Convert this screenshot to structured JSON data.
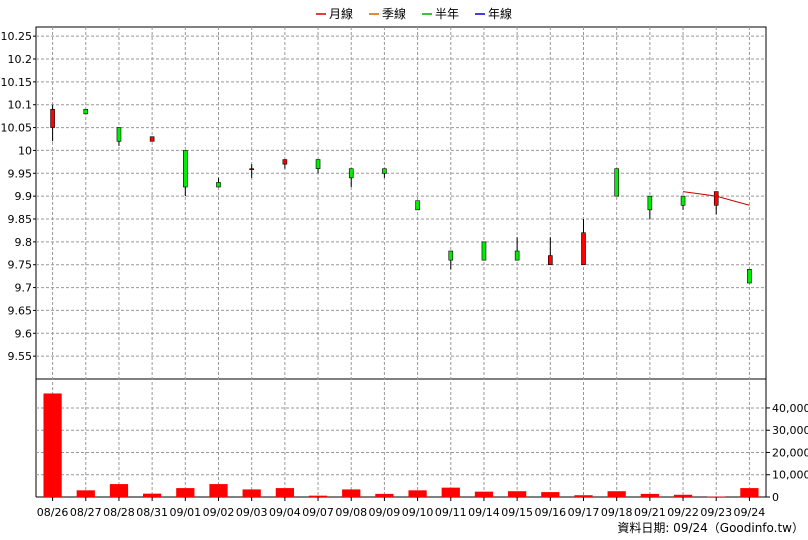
{
  "chart_data": {
    "type": "candlestick",
    "legend": [
      {
        "label": "月線",
        "color": "#cc0000"
      },
      {
        "label": "季線",
        "color": "#cc6600"
      },
      {
        "label": "半年",
        "color": "#00aa00"
      },
      {
        "label": "年線",
        "color": "#0000cc"
      }
    ],
    "categories": [
      "08/26",
      "08/27",
      "08/28",
      "08/31",
      "09/01",
      "09/02",
      "09/03",
      "09/04",
      "09/07",
      "09/08",
      "09/09",
      "09/10",
      "09/11",
      "09/14",
      "09/15",
      "09/16",
      "09/17",
      "09/18",
      "09/21",
      "09/22",
      "09/23",
      "09/24"
    ],
    "price_axis": {
      "ylim": [
        9.5,
        10.27
      ],
      "ticks": [
        "9.55",
        "9.6",
        "9.65",
        "9.7",
        "9.75",
        "9.8",
        "9.85",
        "9.9",
        "9.95",
        "10",
        "10.05",
        "10.1",
        "10.15",
        "10.2",
        "10.25"
      ]
    },
    "candles": [
      {
        "open": 10.05,
        "high": 10.1,
        "low": 10.02,
        "close": 10.09
      },
      {
        "open": 10.09,
        "high": 10.09,
        "low": 10.08,
        "close": 10.08
      },
      {
        "open": 10.05,
        "high": 10.05,
        "low": 10.01,
        "close": 10.02
      },
      {
        "open": 10.02,
        "high": 10.03,
        "low": 10.02,
        "close": 10.03
      },
      {
        "open": 10.0,
        "high": 10.0,
        "low": 9.9,
        "close": 9.92
      },
      {
        "open": 9.93,
        "high": 9.94,
        "low": 9.92,
        "close": 9.92
      },
      {
        "open": 9.96,
        "high": 9.97,
        "low": 9.94,
        "close": 9.96
      },
      {
        "open": 9.97,
        "high": 9.98,
        "low": 9.96,
        "close": 9.98
      },
      {
        "open": 9.98,
        "high": 9.98,
        "low": 9.95,
        "close": 9.96
      },
      {
        "open": 9.96,
        "high": 9.96,
        "low": 9.92,
        "close": 9.94
      },
      {
        "open": 9.96,
        "high": 9.96,
        "low": 9.94,
        "close": 9.95
      },
      {
        "open": 9.89,
        "high": 9.89,
        "low": 9.87,
        "close": 9.87
      },
      {
        "open": 9.78,
        "high": 9.78,
        "low": 9.74,
        "close": 9.76
      },
      {
        "open": 9.8,
        "high": 9.8,
        "low": 9.76,
        "close": 9.76
      },
      {
        "open": 9.78,
        "high": 9.81,
        "low": 9.76,
        "close": 9.76
      },
      {
        "open": 9.75,
        "high": 9.81,
        "low": 9.75,
        "close": 9.77
      },
      {
        "open": 9.75,
        "high": 9.85,
        "low": 9.75,
        "close": 9.82
      },
      {
        "open": 9.96,
        "high": 9.96,
        "low": 9.9,
        "close": 9.9
      },
      {
        "open": 9.9,
        "high": 9.9,
        "low": 9.85,
        "close": 9.87
      },
      {
        "open": 9.9,
        "high": 9.9,
        "low": 9.87,
        "close": 9.88
      },
      {
        "open": 9.88,
        "high": 9.91,
        "low": 9.86,
        "close": 9.91
      },
      {
        "open": 9.74,
        "high": 9.74,
        "low": 9.71,
        "close": 9.71
      }
    ],
    "monthly_ma": {
      "start_index": 19,
      "values": [
        9.91,
        9.9,
        9.88
      ]
    },
    "volume_axis": {
      "ylim": [
        0,
        53000
      ],
      "ticks": [
        {
          "value": 0,
          "label": "0"
        },
        {
          "value": 10000,
          "label": "10,000"
        },
        {
          "value": 20000,
          "label": "20,000"
        },
        {
          "value": 30000,
          "label": "30,000"
        },
        {
          "value": 40000,
          "label": "40,000"
        }
      ]
    },
    "volumes": [
      46500,
      3000,
      5800,
      1500,
      4000,
      5800,
      3400,
      4000,
      600,
      3400,
      1400,
      3000,
      4200,
      2400,
      2600,
      2200,
      800,
      2600,
      1400,
      1000,
      200,
      4000
    ],
    "colors": {
      "up": "#ff0000",
      "down": "#00ee00",
      "volume": "#ff0000",
      "ma": "#cc0000",
      "grid": "#999999"
    },
    "footer": "資料日期: 09/24（Goodinfo.tw）"
  }
}
